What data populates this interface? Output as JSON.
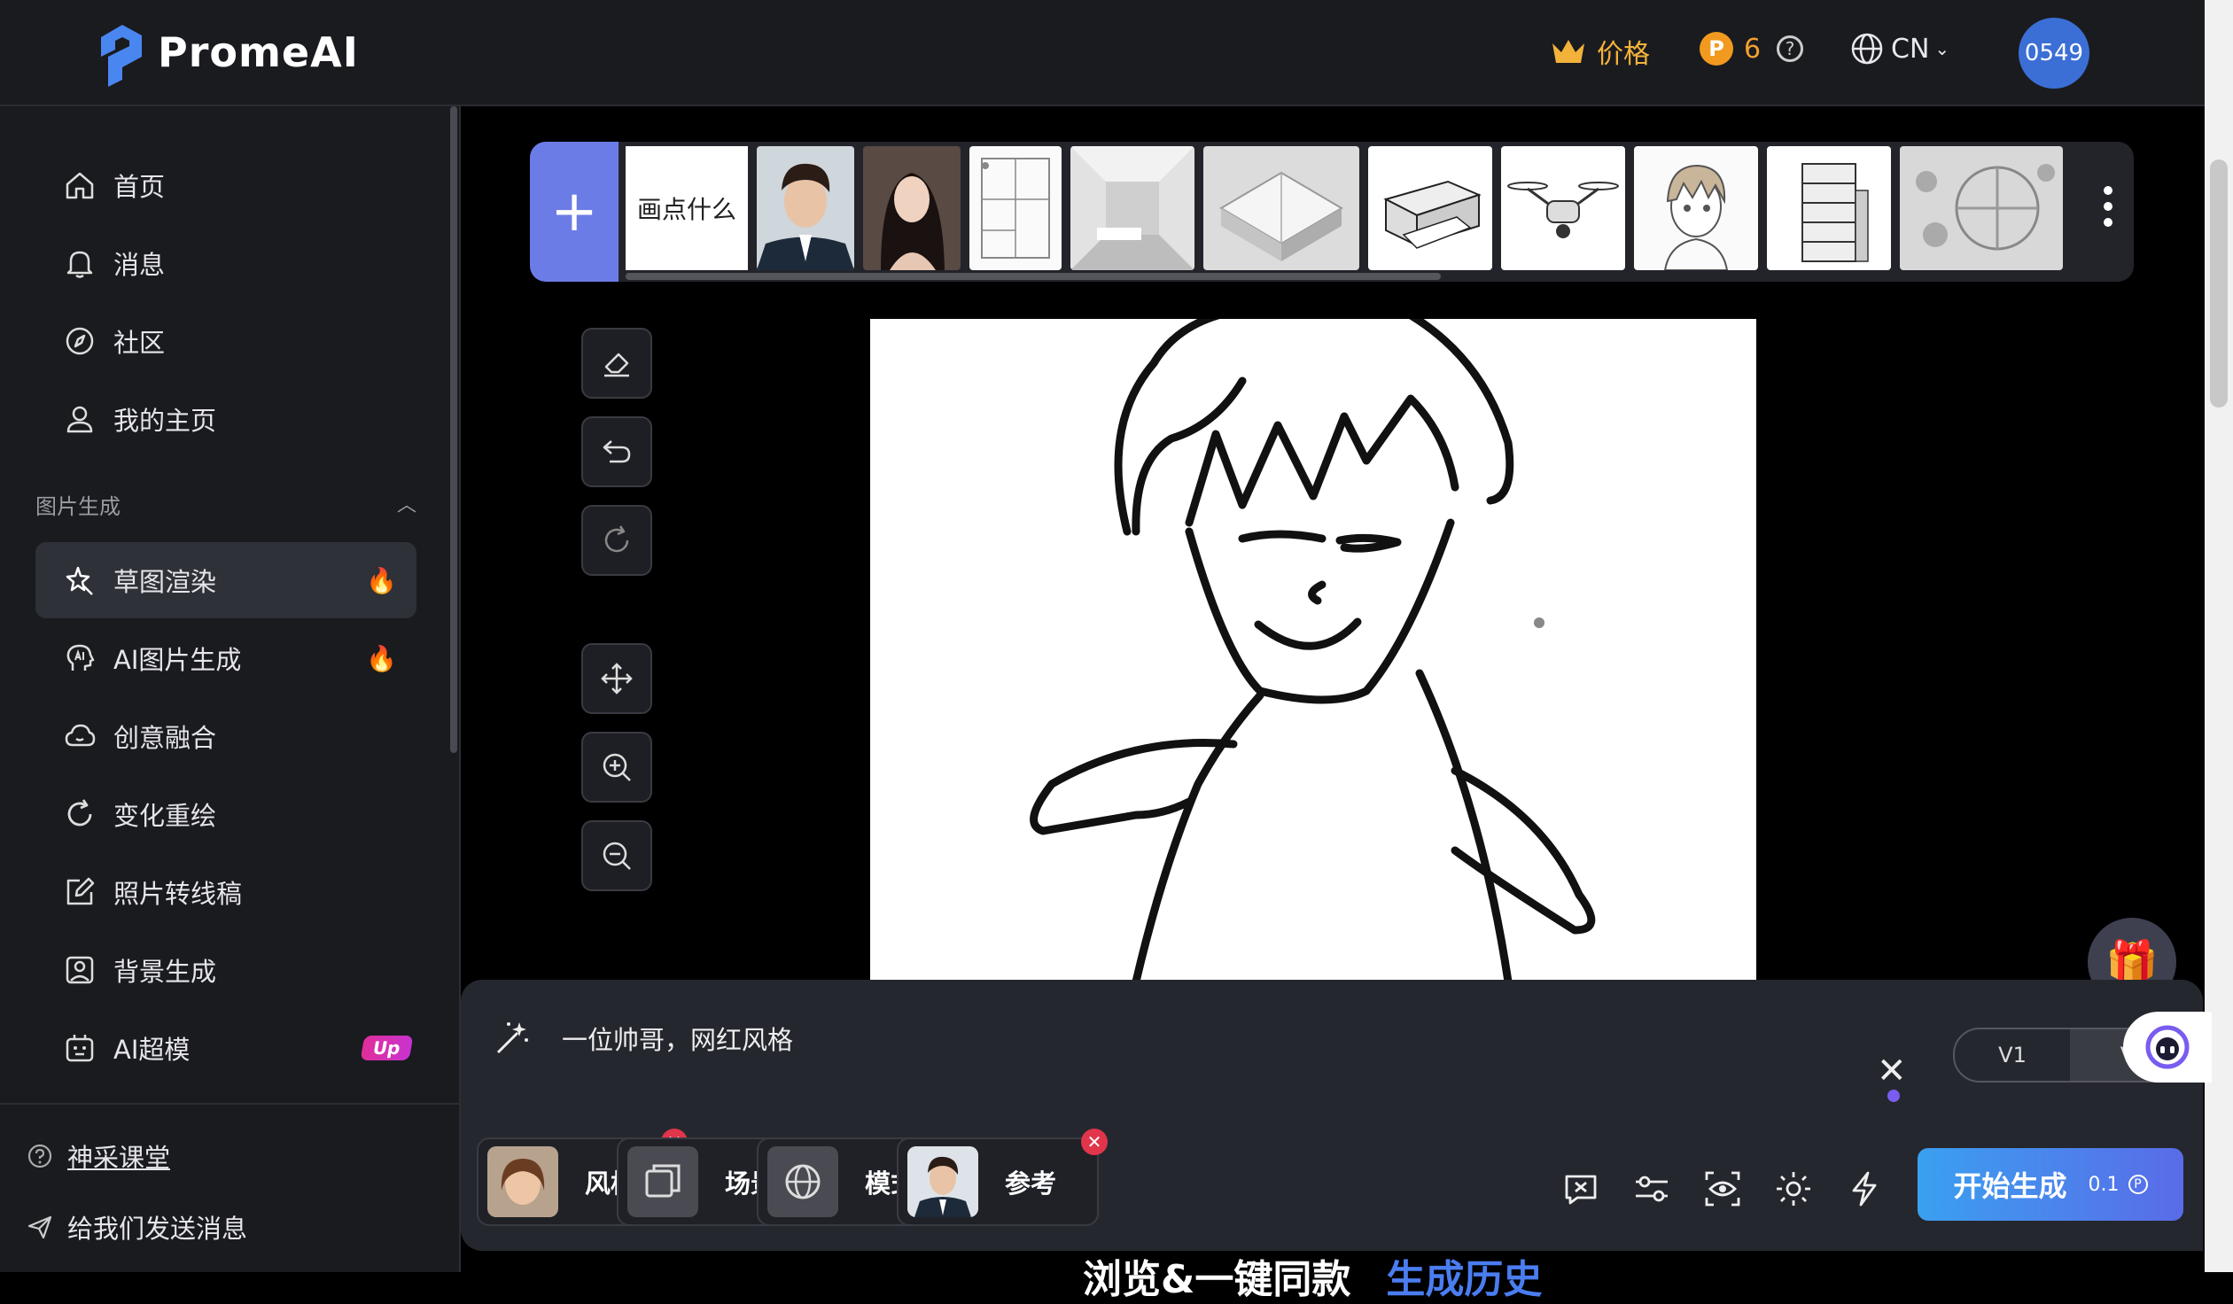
{
  "header": {
    "brand": "PromeAI",
    "price_label": "价格",
    "credits_count": "6",
    "language": "CN",
    "user_avatar_text": "0549"
  },
  "sidebar": {
    "main_items": [
      {
        "label": "首页",
        "icon": "home-icon"
      },
      {
        "label": "消息",
        "icon": "bell-icon"
      },
      {
        "label": "社区",
        "icon": "compass-icon"
      },
      {
        "label": "我的主页",
        "icon": "user-icon"
      }
    ],
    "section_title": "图片生成",
    "section_items": [
      {
        "label": "草图渲染",
        "icon": "sketch-star-icon",
        "active": true,
        "badge": "fire"
      },
      {
        "label": "AI图片生成",
        "icon": "ai-head-icon",
        "badge": "fire"
      },
      {
        "label": "创意融合",
        "icon": "cloud-icon"
      },
      {
        "label": "变化重绘",
        "icon": "refresh-icon"
      },
      {
        "label": "照片转线稿",
        "icon": "edit-icon"
      },
      {
        "label": "背景生成",
        "icon": "image-icon"
      },
      {
        "label": "AI超模",
        "icon": "robot-icon",
        "badge_text": "Up"
      }
    ],
    "footer_items": [
      {
        "label": "神采课堂",
        "icon": "question-icon"
      },
      {
        "label": "给我们发送消息",
        "icon": "send-icon"
      }
    ]
  },
  "template_strip": {
    "text_template": "画点什么"
  },
  "prompt": {
    "text": "一位帅哥，网红风格"
  },
  "version_toggle": [
    "V1",
    "V"
  ],
  "options": [
    {
      "label": "风格"
    },
    {
      "label": "场景"
    },
    {
      "label": "模式"
    },
    {
      "label": "参考"
    }
  ],
  "generate": {
    "label": "开始生成",
    "cost": "0.1"
  },
  "below_fold": {
    "text": "浏览&一键同款",
    "link": "生成历史"
  },
  "colors": {
    "accent": "#6c7ce6",
    "price": "#f3b23a",
    "badge": "#e0354b",
    "generate_start": "#3aa0f0",
    "generate_end": "#5a6be8"
  }
}
